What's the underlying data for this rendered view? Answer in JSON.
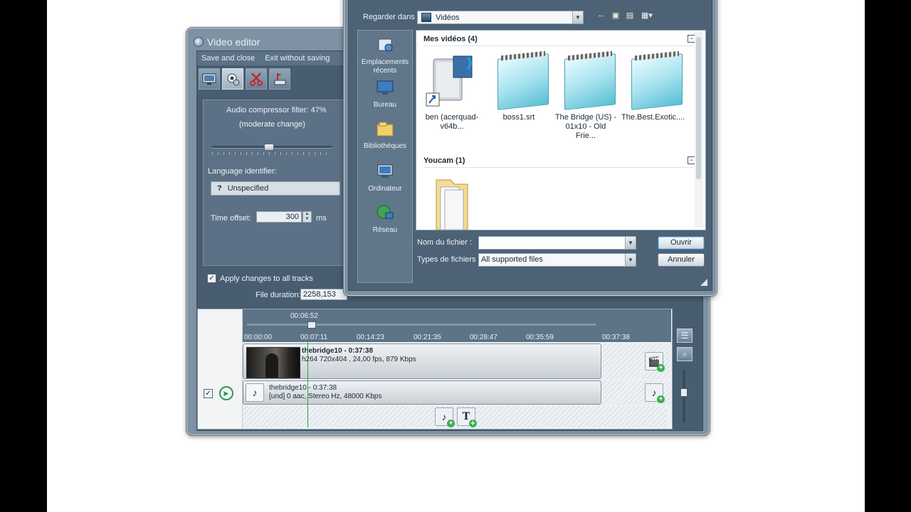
{
  "video_editor": {
    "title": "Video editor",
    "menu": [
      "Save and close",
      "Exit without saving"
    ],
    "filter_label": "Audio compressor filter: 47%",
    "filter_desc": "(moderate change)",
    "filter_level_percent": 47,
    "language_label": "Language identifier:",
    "language_icon_text": "?",
    "language_value": "Unspecified",
    "time_offset_label": "Time offset:",
    "time_offset_value": "300",
    "time_offset_unit": "ms",
    "apply_label": "Apply changes to all tracks",
    "apply_checked": true,
    "file_duration_label": "File duration:",
    "file_duration_value": "2258,153",
    "timeline": {
      "cursor_time": "00:06:52",
      "ticks": [
        "00:00:00",
        "00:07:11",
        "00:14:23",
        "00:21:35",
        "00:28:47",
        "00:35:59",
        "00:37:38"
      ],
      "video_track": {
        "title": "thebridge10 - 0:37:38",
        "info": "h264 720x404 , 24,00 fps, 879 Kbps"
      },
      "audio_track": {
        "title": "thebridge10 - 0:37:38",
        "info": "[und] 0 aac, Stereo Hz, 48000 Kbps"
      }
    }
  },
  "open_dialog": {
    "look_in_label": "Regarder dans :",
    "look_in_value": "Vidéos",
    "places": [
      "Emplacements récents",
      "Bureau",
      "Bibliothèques",
      "Ordinateur",
      "Réseau"
    ],
    "groups": [
      {
        "name": "Mes vidéos (4)",
        "files": [
          "ben (acerquad-v64b...",
          "boss1.srt",
          "The Bridge (US) - 01x10 - Old Frie...",
          "The.Best.Exotic...."
        ]
      },
      {
        "name": "Youcam (1)",
        "files": [
          ""
        ]
      }
    ],
    "filename_label": "Nom du fichier :",
    "filename_value": "",
    "filetype_label": "Types de fichiers :",
    "filetype_value": "All supported files",
    "open_button": "Ouvrir",
    "cancel_button": "Annuler"
  },
  "colors": {
    "window_frame": "#7f92a3",
    "panel": "#485d70",
    "playhead": "#21a23f",
    "accent_green": "#3aae4f"
  }
}
